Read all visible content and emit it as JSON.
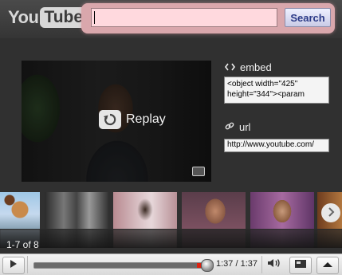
{
  "header": {
    "logo_text_you": "You",
    "logo_text_tube": "Tube",
    "search": {
      "value": "",
      "button_label": "Search"
    }
  },
  "player": {
    "replay_label": "Replay",
    "progress_fraction": 1.0,
    "time_text": "1:37 / 1:37"
  },
  "share": {
    "embed_title": "embed",
    "embed_code": "<object width=\"425\" height=\"344\"><param",
    "url_title": "url",
    "url_value": "http://www.youtube.com/"
  },
  "related": {
    "counter": "1-7 of 8",
    "thumbnails": [
      {
        "name": "cartoon"
      },
      {
        "name": "bw-street"
      },
      {
        "name": "room-chair"
      },
      {
        "name": "man-portrait"
      },
      {
        "name": "hooded-man"
      },
      {
        "name": "smiling-guy"
      }
    ]
  },
  "colors": {
    "header_bg": "#3f3f3f",
    "search_glow": "#d9a7ac",
    "search_input_bg": "#ffd9de",
    "search_button_text": "#2b3a87",
    "progress_played_marker": "#dd2211"
  },
  "icons": {
    "embed": "code-brackets-icon",
    "url": "link-icon",
    "replay": "replay-icon",
    "next": "chevron-right-icon",
    "play": "play-icon",
    "volume": "speaker-icon",
    "size": "screen-size-icon",
    "menu": "eject-up-icon"
  }
}
